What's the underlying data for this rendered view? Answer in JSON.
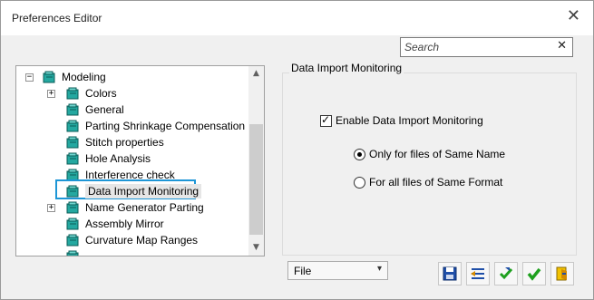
{
  "window": {
    "title": "Preferences Editor",
    "close_glyph": "✕"
  },
  "search": {
    "placeholder": "Search",
    "value": "",
    "clear_glyph": "✕"
  },
  "tree": {
    "root": {
      "label": "Modeling",
      "expander": "−",
      "icon": "modeling-folder-icon"
    },
    "items": [
      {
        "label": "Colors",
        "expander": "+",
        "icon": "preference-node-icon"
      },
      {
        "label": "General",
        "icon": "preference-node-icon"
      },
      {
        "label": "Parting Shrinkage Compensation",
        "icon": "preference-node-icon"
      },
      {
        "label": "Stitch properties",
        "icon": "preference-node-icon"
      },
      {
        "label": "Hole Analysis",
        "icon": "preference-node-icon"
      },
      {
        "label": "Interference check",
        "icon": "preference-node-icon"
      },
      {
        "label": "Data Import Monitoring",
        "icon": "preference-node-icon",
        "selected": true
      },
      {
        "label": "Name Generator Parting",
        "expander": "+",
        "icon": "preference-node-icon"
      },
      {
        "label": "Assembly Mirror",
        "icon": "preference-node-icon"
      },
      {
        "label": "Curvature Map Ranges",
        "icon": "preference-node-icon"
      }
    ]
  },
  "panel": {
    "title": "Data Import Monitoring",
    "enable_checkbox": {
      "label": "Enable Data Import Monitoring",
      "checked": true
    },
    "radio_same_name": {
      "label": "Only for files of Same Name",
      "selected": true
    },
    "radio_same_format": {
      "label": "For all files of Same Format",
      "selected": false
    }
  },
  "footer": {
    "scope_select": {
      "value": "File",
      "arrow": "▾"
    },
    "buttons": [
      "save-icon",
      "import-export-icon",
      "apply-icon",
      "ok-icon",
      "exit-icon"
    ]
  },
  "colors": {
    "selection_border": "#1e96d6",
    "ok_green": "#1ea01e",
    "save_blue": "#1f4fa8"
  }
}
